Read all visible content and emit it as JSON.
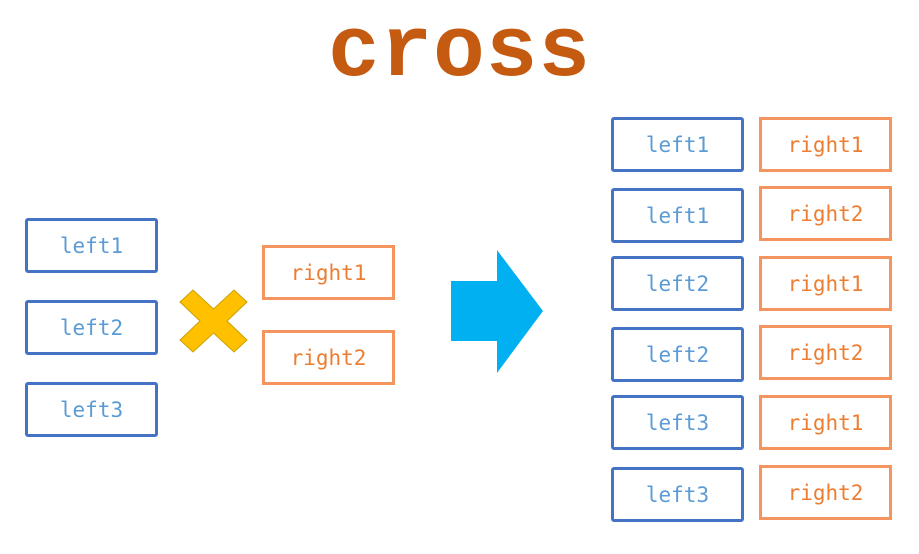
{
  "title": "cross",
  "colors": {
    "title": "#c55a11",
    "left_border": "#4472c4",
    "left_text": "#5b9bd5",
    "right_border": "#f4955f",
    "right_text": "#ed7d31",
    "cross_fill": "#ffc000",
    "arrow_fill": "#00b0f0"
  },
  "inputs": {
    "left": [
      "left1",
      "left2",
      "left3"
    ],
    "right": [
      "right1",
      "right2"
    ]
  },
  "operator_icon": "multiply-cross-icon",
  "result_icon": "right-arrow-icon",
  "result": [
    {
      "left": "left1",
      "right": "right1"
    },
    {
      "left": "left1",
      "right": "right2"
    },
    {
      "left": "left2",
      "right": "right1"
    },
    {
      "left": "left2",
      "right": "right2"
    },
    {
      "left": "left3",
      "right": "right1"
    },
    {
      "left": "left3",
      "right": "right2"
    }
  ]
}
